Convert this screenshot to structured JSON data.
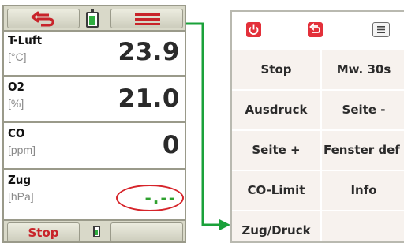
{
  "left_screen": {
    "readings": [
      {
        "label": "T-Luft",
        "unit": "[°C]",
        "value": "23.9"
      },
      {
        "label": "O2",
        "unit": "[%]",
        "value": "21.0"
      },
      {
        "label": "CO",
        "unit": "[ppm]",
        "value": "0"
      },
      {
        "label": "Zug",
        "unit": "[hPa]",
        "value": "-.--"
      }
    ],
    "bottom_bar": {
      "stop_label": "Stop"
    }
  },
  "right_screen": {
    "menu_left": [
      "Stop",
      "Ausdruck",
      "Seite +",
      "CO-Limit",
      "Zug/Druck"
    ],
    "menu_right": [
      "Mw. 30s",
      "Seite -",
      "Fenster def",
      "Info"
    ]
  },
  "colors": {
    "accent_red": "#e3303a",
    "status_green": "#2fa12f",
    "bar_beige": "#d9d9c9",
    "menu_cell": "#f7f2ee"
  },
  "icons": [
    "back-arrow-icon",
    "battery-icon",
    "menu-lines-icon",
    "power-icon"
  ]
}
